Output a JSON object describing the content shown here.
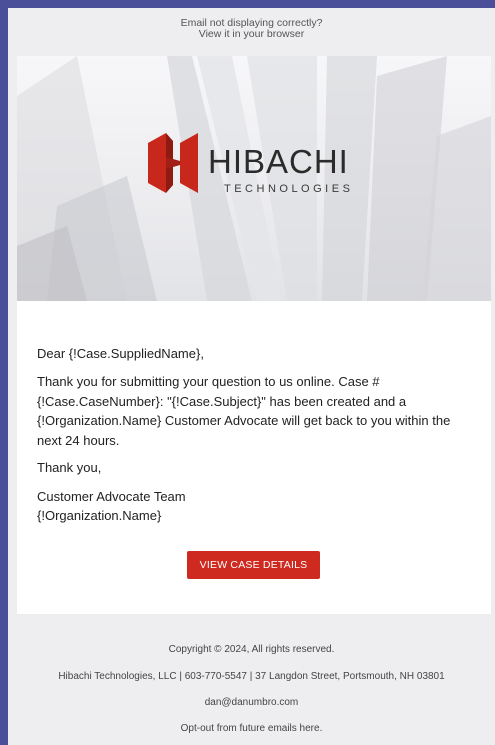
{
  "header": {
    "line1": "Email not displaying correctly?",
    "line2": "View it in your browser"
  },
  "logo": {
    "name": "HIBACHI",
    "tagline": "TECHNOLOGIES",
    "colors": {
      "red": "#c8281c",
      "dark_red": "#8e1a12"
    }
  },
  "email": {
    "greeting": "Dear {!Case.SuppliedName},",
    "body": "Thank you for submitting your question to us online. Case # {!Case.CaseNumber}: \"{!Case.Subject}\" has been created and a {!Organization.Name} Customer Advocate will get back to you within the next 24 hours.",
    "thanks": "Thank you,",
    "signature_line1": "Customer Advocate Team",
    "signature_line2": "{!Organization.Name}",
    "button_label": "VIEW CASE DETAILS",
    "button_color": "#cf2a1f"
  },
  "footer": {
    "copyright": "Copyright © 2024, All rights reserved.",
    "address": "Hibachi Technologies, LLC | 603-770-5547 | 37 Langdon Street, Portsmouth, NH 03801",
    "email": "dan@danumbro.com",
    "optout": "Opt-out from future emails here."
  }
}
